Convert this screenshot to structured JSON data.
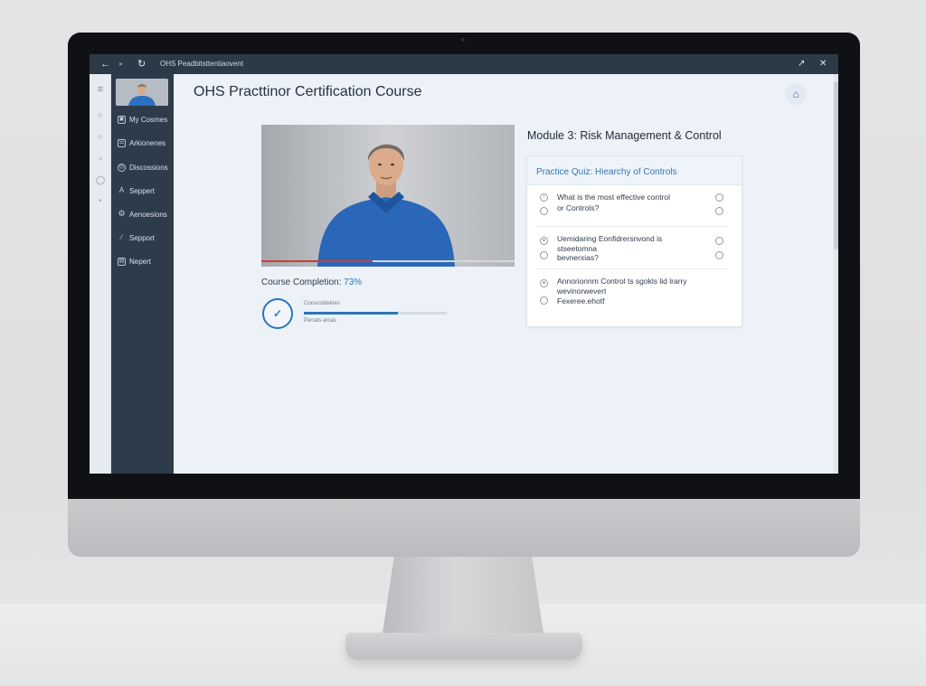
{
  "window": {
    "title": "OHS Peadbitsttentiaovent",
    "back_glyph": "←",
    "forward_glyph": "▸",
    "reload_glyph": "↻",
    "popout_glyph": "↗",
    "close_glyph": "✕"
  },
  "rail": {
    "menu_glyph": "≡",
    "icons": [
      "document-icon",
      "clipboard-icon",
      "file-icon",
      "info-icon",
      "dot-icon"
    ]
  },
  "sidebar": {
    "items": [
      {
        "label": "My Cosmes",
        "icon": "courses-icon",
        "glyph": "▣"
      },
      {
        "label": "Arkionenes",
        "icon": "list-icon",
        "glyph": "☰"
      },
      {
        "label": "Discossions",
        "icon": "discussion-icon",
        "glyph": "◎"
      },
      {
        "label": "Seppert",
        "icon": "person-icon",
        "glyph": "A"
      },
      {
        "label": "Aenoesions",
        "icon": "gear-icon",
        "glyph": "⚙"
      },
      {
        "label": "Sepport",
        "icon": "link-icon",
        "glyph": "∕"
      },
      {
        "label": "Nepert",
        "icon": "report-icon",
        "glyph": "▤"
      }
    ]
  },
  "main": {
    "title": "OHS Practtinor Certification Course",
    "help_glyph": "⌂",
    "video": {
      "progress_fraction": 0.44
    },
    "completion": {
      "label": "Course Completion:",
      "value": "73%"
    },
    "badge_glyph": "✓",
    "mini_label_top": "Consostdeines",
    "mini_label_bottom": "Perrats arcas",
    "mini_progress_fraction": 0.66,
    "module_title": "Module 3: Risk Management & Control",
    "quiz": {
      "heading": "Practice Quiz: Hiearchy of Controls",
      "questions": [
        {
          "line1": "What is the most effective control",
          "line2": "or Controls?"
        },
        {
          "line1": "Uemidaring Eonfidrersnvond is",
          "line2": "stseetomna",
          "line3": "bevnerxias?"
        },
        {
          "line1": "Annorionnm Control ts sgokls lid lrarry",
          "line2": "wevinorwevert",
          "line3": "Fexeree.ehotf"
        }
      ]
    }
  }
}
